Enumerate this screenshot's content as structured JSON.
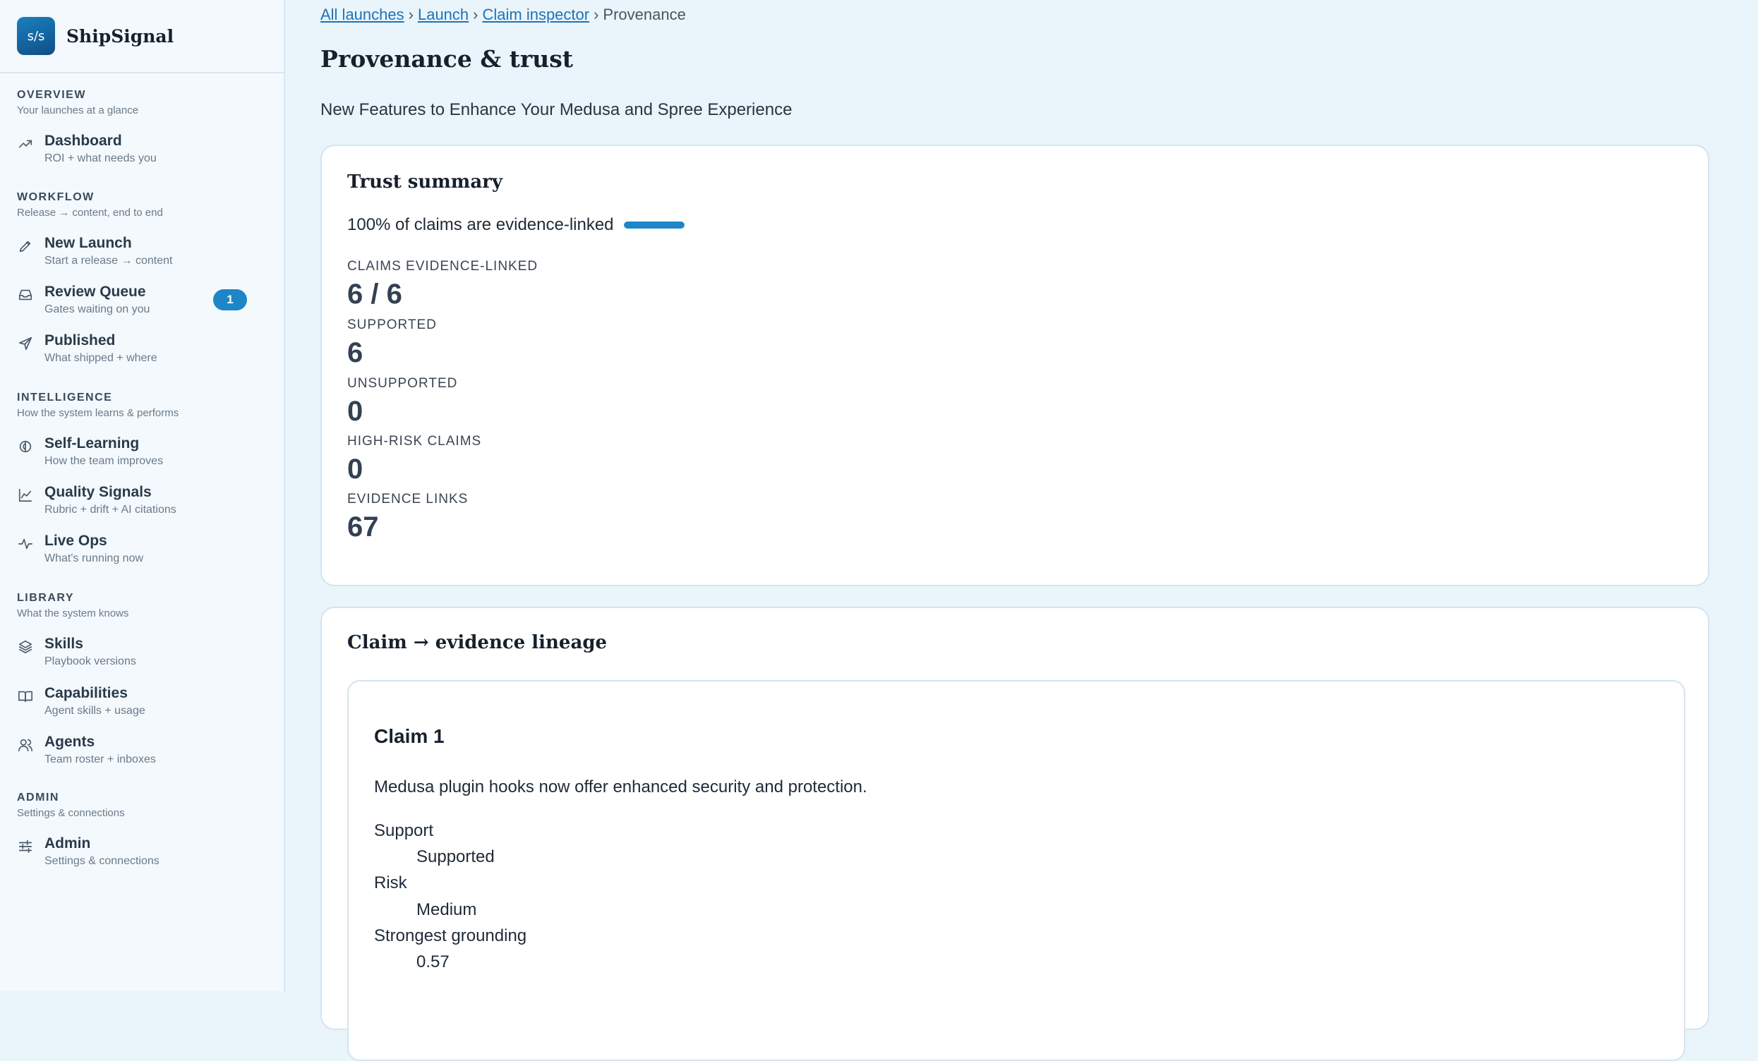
{
  "brand": {
    "logo_text": "s/s",
    "name": "ShipSignal"
  },
  "sidebar": {
    "sections": [
      {
        "title": "OVERVIEW",
        "sub": "Your launches at a glance"
      },
      {
        "title": "WORKFLOW",
        "sub": "Release → content, end to end"
      },
      {
        "title": "INTELLIGENCE",
        "sub": "How the system learns & performs"
      },
      {
        "title": "LIBRARY",
        "sub": "What the system knows"
      },
      {
        "title": "ADMIN",
        "sub": "Settings & connections"
      }
    ],
    "items": [
      {
        "label": "Dashboard",
        "sub": "ROI + what needs you",
        "icon": "trend-icon"
      },
      {
        "label": "New Launch",
        "sub": "Start a release → content",
        "icon": "pencil-icon"
      },
      {
        "label": "Review Queue",
        "sub": "Gates waiting on you",
        "icon": "inbox-icon",
        "badge": "1"
      },
      {
        "label": "Published",
        "sub": "What shipped + where",
        "icon": "send-icon"
      },
      {
        "label": "Self-Learning",
        "sub": "How the team improves",
        "icon": "brain-icon"
      },
      {
        "label": "Quality Signals",
        "sub": "Rubric + drift + AI citations",
        "icon": "chart-icon"
      },
      {
        "label": "Live Ops",
        "sub": "What's running now",
        "icon": "pulse-icon"
      },
      {
        "label": "Skills",
        "sub": "Playbook versions",
        "icon": "layers-icon"
      },
      {
        "label": "Capabilities",
        "sub": "Agent skills + usage",
        "icon": "book-icon"
      },
      {
        "label": "Agents",
        "sub": "Team roster + inboxes",
        "icon": "users-icon"
      },
      {
        "label": "Admin",
        "sub": "Settings & connections",
        "icon": "sliders-icon"
      }
    ]
  },
  "breadcrumb": {
    "items": [
      "All launches",
      "Launch",
      "Claim inspector"
    ],
    "current": "Provenance",
    "sep": "›"
  },
  "page": {
    "title": "Provenance & trust",
    "subtitle": "New Features to Enhance Your Medusa and Spree Experience"
  },
  "trust": {
    "title": "Trust summary",
    "pct_text": "100% of claims are evidence-linked",
    "pct_value": 100,
    "stats": [
      {
        "label": "CLAIMS EVIDENCE-LINKED",
        "value": "6 / 6"
      },
      {
        "label": "SUPPORTED",
        "value": "6"
      },
      {
        "label": "UNSUPPORTED",
        "value": "0"
      },
      {
        "label": "HIGH-RISK CLAIMS",
        "value": "0"
      },
      {
        "label": "EVIDENCE LINKS",
        "value": "67"
      }
    ]
  },
  "lineage": {
    "title": "Claim → evidence lineage",
    "claim": {
      "title": "Claim 1",
      "text": "Medusa plugin hooks now offer enhanced security and protection.",
      "fields": [
        {
          "key": "Support",
          "value": "Supported"
        },
        {
          "key": "Risk",
          "value": "Medium"
        },
        {
          "key": "Strongest grounding",
          "value": "0.57"
        }
      ]
    }
  },
  "colors": {
    "accent": "#1d86c7",
    "link": "#1e73b6",
    "background": "#e9f4fb"
  }
}
